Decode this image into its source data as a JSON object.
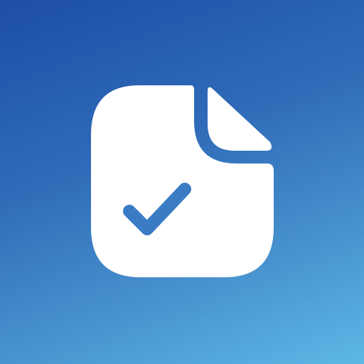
{
  "app_icon": {
    "name": "document-check-icon",
    "colors": {
      "background_start": "#1d4fa6",
      "background_end": "#5cb8e6",
      "glyph": "#ffffff",
      "check": "#3a7cc4"
    }
  }
}
